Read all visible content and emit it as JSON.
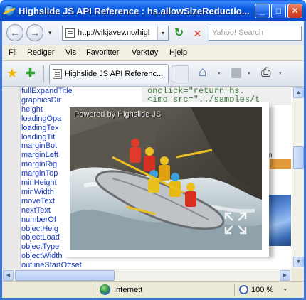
{
  "window": {
    "title": "Highslide JS API Reference : hs.allowSizeReductio...",
    "minimize_glyph": "_",
    "maximize_glyph": "□",
    "close_glyph": "✕"
  },
  "navigation": {
    "back_glyph": "←",
    "forward_glyph": "→",
    "history_glyph": "▾",
    "address": "http://vikjavev.no/higl",
    "address_drop_glyph": "▾",
    "refresh_glyph": "↻",
    "stop_glyph": "✕",
    "search_placeholder": "Yahoo! Search"
  },
  "menu": {
    "items": [
      "Fil",
      "Rediger",
      "Vis",
      "Favoritter",
      "Verktøy",
      "Hjelp"
    ]
  },
  "favorites_bar": {
    "favorites_glyph": "★",
    "add_favorite_glyph": "✚",
    "tab_label": "Highslide JS API Referenc...",
    "home_glyph": "⌂",
    "print_glyph": "⎙",
    "drop_glyph": "▾"
  },
  "sidebar": {
    "items": [
      "fullExpandTitle",
      "graphicsDir",
      "height",
      "loadingOpa",
      "loadingTex",
      "loadingTitl",
      "marginBot",
      "marginLeft",
      "marginRig",
      "marginTop",
      "minHeight",
      "minWidth",
      "moveText",
      "nextText",
      "numberOf",
      "objectHeig",
      "objectLoad",
      "objectType",
      "objectWidth",
      "outlineStartOffset"
    ]
  },
  "code": {
    "line1": "onclick=\"return hs.",
    "line2": "<img src=\"../samples/t",
    "partial_word": "than"
  },
  "highslide": {
    "credit": "Powered by Highslide JS"
  },
  "scrollbars": {
    "up_glyph": "▲",
    "down_glyph": "▼",
    "left_glyph": "◀",
    "right_glyph": "▶"
  },
  "status": {
    "zone": "Internett",
    "zoom": "100 %",
    "zoom_drop_glyph": "▾"
  }
}
